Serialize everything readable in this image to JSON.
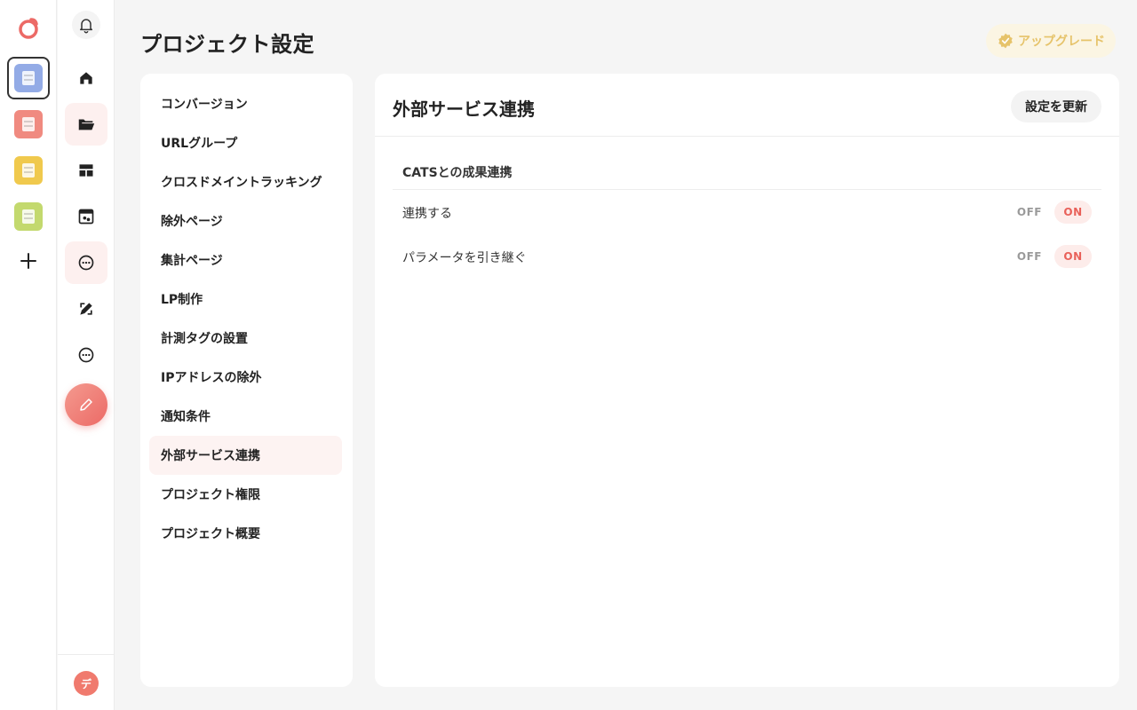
{
  "page": {
    "title": "プロジェクト設定"
  },
  "header": {
    "upgrade_label": "アップグレード"
  },
  "projects": [
    {
      "color": "#93abe6",
      "active": true
    },
    {
      "color": "#f08a80",
      "active": false
    },
    {
      "color": "#f0c94d",
      "active": false
    },
    {
      "color": "#c3d96e",
      "active": false
    }
  ],
  "nav": {
    "icons": [
      "bell-icon",
      "home-icon",
      "folder-open-icon",
      "dashboard-icon",
      "analytics-icon",
      "more-horizontal-icon",
      "design-tools-icon",
      "more-circle-icon",
      "pencil-icon"
    ],
    "user_avatar_initial": "デ"
  },
  "settings_menu": {
    "items": [
      {
        "label": "コンバージョン"
      },
      {
        "label": "URLグループ"
      },
      {
        "label": "クロスドメイントラッキング"
      },
      {
        "label": "除外ページ"
      },
      {
        "label": "集計ページ"
      },
      {
        "label": "LP制作"
      },
      {
        "label": "計測タグの設置"
      },
      {
        "label": "IPアドレスの除外"
      },
      {
        "label": "通知条件"
      },
      {
        "label": "外部サービス連携"
      },
      {
        "label": "プロジェクト権限"
      },
      {
        "label": "プロジェクト概要"
      }
    ],
    "active_index": 9
  },
  "panel": {
    "title": "外部サービス連携",
    "update_button": "設定を更新",
    "section_title": "CATSとの成果連携",
    "rows": [
      {
        "label": "連携する",
        "off_label": "OFF",
        "on_label": "ON",
        "value": "ON"
      },
      {
        "label": "パラメータを引き継ぐ",
        "off_label": "OFF",
        "on_label": "ON",
        "value": "ON"
      }
    ]
  },
  "colors": {
    "accent": "#ec6a66",
    "upgrade": "#e6c36a",
    "background": "#f5f5f5"
  }
}
